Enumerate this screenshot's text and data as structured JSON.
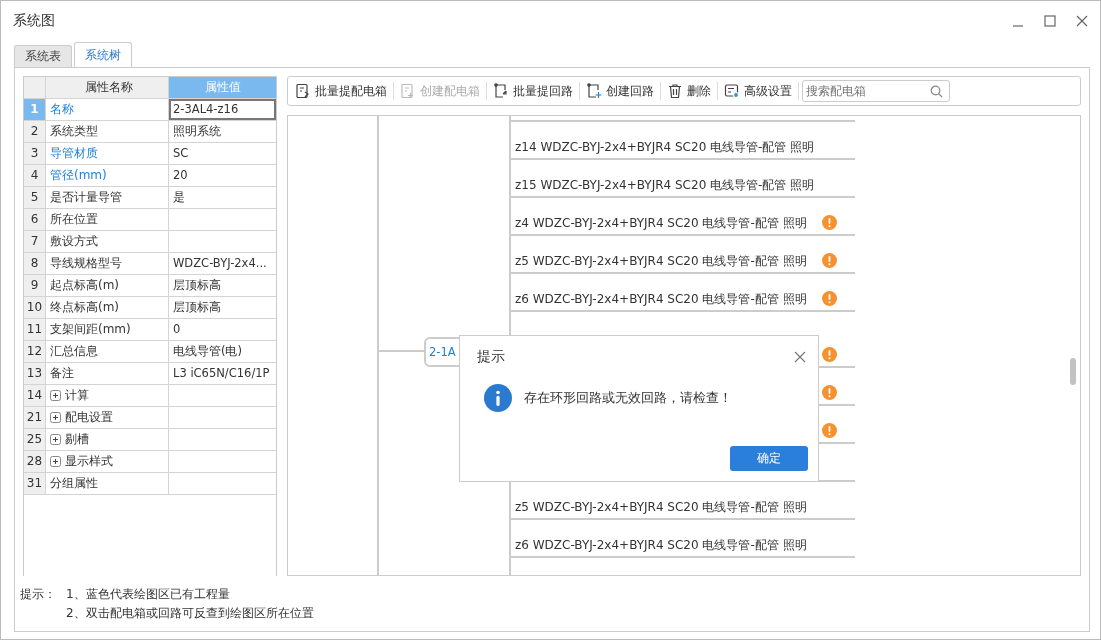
{
  "window": {
    "title": "系统图"
  },
  "tabs": [
    {
      "label": "系统表",
      "selected": false
    },
    {
      "label": "系统树",
      "selected": true
    }
  ],
  "property_grid": {
    "columns": [
      "属性名称",
      "属性值"
    ],
    "rows": [
      {
        "index": "1",
        "name": "名称",
        "value": "2-3AL4-z16",
        "kind": "field",
        "blue": true,
        "selected": true
      },
      {
        "index": "2",
        "name": "系统类型",
        "value": "照明系统",
        "kind": "field",
        "blue": false,
        "selected": false
      },
      {
        "index": "3",
        "name": "导管材质",
        "value": "SC",
        "kind": "field",
        "blue": true,
        "selected": false
      },
      {
        "index": "4",
        "name": "管径(mm)",
        "value": "20",
        "kind": "field",
        "blue": true,
        "selected": false
      },
      {
        "index": "5",
        "name": "是否计量导管",
        "value": "是",
        "kind": "field",
        "blue": false,
        "selected": false
      },
      {
        "index": "6",
        "name": "所在位置",
        "kind": "field",
        "blue": false,
        "selected": false
      },
      {
        "index": "7",
        "name": "敷设方式",
        "kind": "field",
        "blue": false,
        "selected": false
      },
      {
        "index": "8",
        "name": "导线规格型号",
        "value": "WDZC-BYJ-2x4...",
        "kind": "field",
        "blue": false,
        "selected": false
      },
      {
        "index": "9",
        "name": "起点标高(m)",
        "value": "层顶标高",
        "kind": "field",
        "blue": false,
        "selected": false
      },
      {
        "index": "10",
        "name": "终点标高(m)",
        "value": "层顶标高",
        "kind": "field",
        "blue": false,
        "selected": false
      },
      {
        "index": "11",
        "name": "支架间距(mm)",
        "value": "0",
        "kind": "field",
        "blue": false,
        "selected": false
      },
      {
        "index": "12",
        "name": "汇总信息",
        "value": "电线导管(电)",
        "kind": "field",
        "blue": false,
        "selected": false
      },
      {
        "index": "13",
        "name": "备注",
        "value": "L3 iC65N/C16/1P",
        "kind": "field",
        "blue": false,
        "selected": false
      },
      {
        "index": "14",
        "name": "计算",
        "kind": "group",
        "expanded": false,
        "blue": false,
        "selected": false
      },
      {
        "index": "21",
        "name": "配电设置",
        "kind": "group",
        "expanded": false,
        "blue": false,
        "selected": false
      },
      {
        "index": "25",
        "name": "剔槽",
        "kind": "group",
        "expanded": false,
        "blue": false,
        "selected": false
      },
      {
        "index": "28",
        "name": "显示样式",
        "kind": "group",
        "expanded": false,
        "blue": false,
        "selected": false
      },
      {
        "index": "31",
        "name": "分组属性",
        "kind": "field",
        "blue": false,
        "selected": false
      }
    ]
  },
  "toolbar": {
    "buttons": [
      {
        "label": "批量提配电箱",
        "kind": "batch-box",
        "disabled": false
      },
      {
        "label": "创建配电箱",
        "kind": "new-box",
        "disabled": true
      },
      {
        "label": "批量提回路",
        "kind": "batch-circuit",
        "disabled": false
      },
      {
        "label": "创建回路",
        "kind": "new-circuit",
        "disabled": false
      },
      {
        "label": "删除",
        "kind": "delete",
        "disabled": false
      },
      {
        "label": "高级设置",
        "kind": "settings",
        "disabled": false
      }
    ],
    "search": {
      "placeholder": "搜索配电箱"
    }
  },
  "tree": {
    "node": {
      "label": "2-1A"
    },
    "groups": [
      {
        "circuits": [
          {
            "warning": false
          },
          {
            "label": "z14 WDZC-BYJ-2x4+BYJR4 SC20 电线导管-配管 照明",
            "warning": false
          },
          {
            "label": "z15 WDZC-BYJ-2x4+BYJR4 SC20 电线导管-配管 照明",
            "warning": false
          },
          {
            "label": "z4 WDZC-BYJ-2x4+BYJR4 SC20 电线导管-配管 照明",
            "warning": true
          },
          {
            "label": "z5 WDZC-BYJ-2x4+BYJR4 SC20 电线导管-配管 照明",
            "warning": true
          },
          {
            "label": "z6 WDZC-BYJ-2x4+BYJR4 SC20 电线导管-配管 照明",
            "warning": true
          }
        ]
      },
      {
        "circuits": [
          {
            "warning": true
          },
          {
            "warning": true
          },
          {
            "warning": true
          },
          {
            "warning": false
          },
          {
            "label": "z5 WDZC-BYJ-2x4+BYJR4 SC20 电线导管-配管 照明",
            "warning": false
          },
          {
            "label": "z6 WDZC-BYJ-2x4+BYJR4 SC20 电线导管-配管 照明",
            "warning": false
          }
        ]
      }
    ]
  },
  "dialog": {
    "title": "提示",
    "message": "存在环形回路或无效回路，请检查！",
    "button": "确定"
  },
  "hints": {
    "label": "提示：",
    "lines": [
      "1、蓝色代表绘图区已有工程量",
      "2、双击配电箱或回路可反查到绘图区所在位置"
    ]
  }
}
